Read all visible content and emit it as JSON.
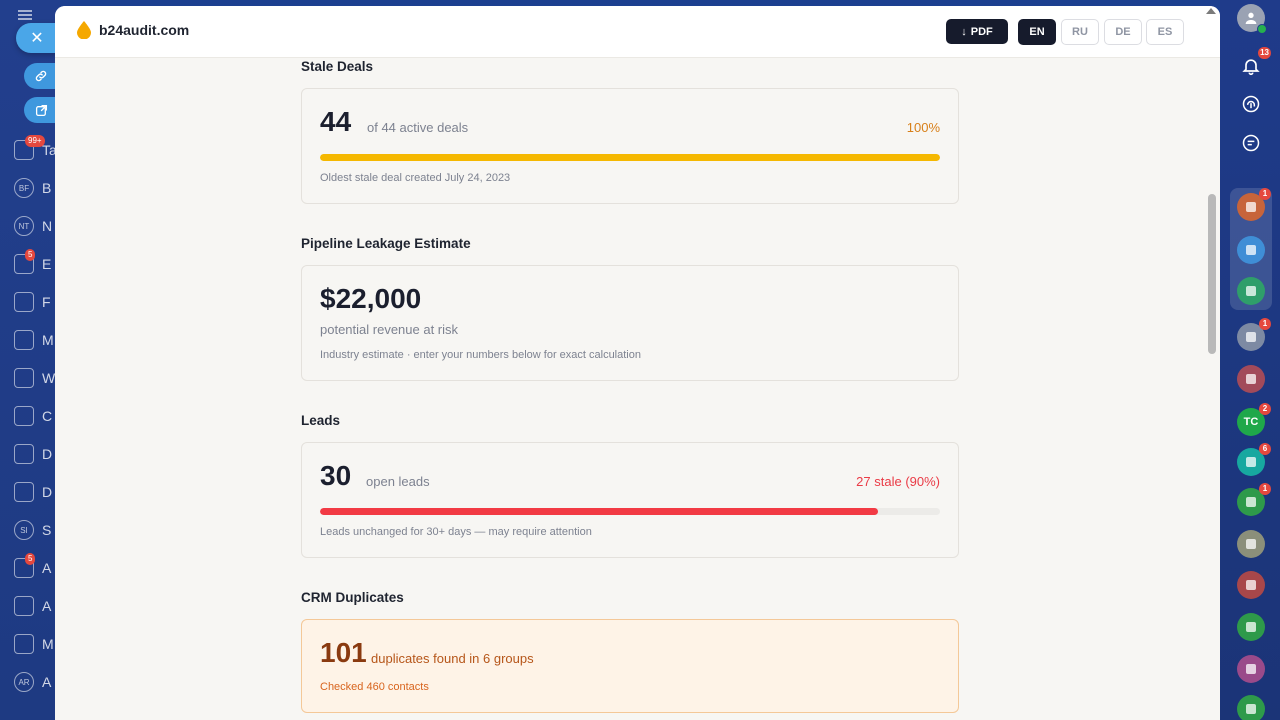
{
  "header": {
    "brand": "b24audit.com",
    "pdf_label": "PDF",
    "languages": [
      {
        "code": "EN",
        "active": true
      },
      {
        "code": "RU",
        "active": false
      },
      {
        "code": "DE",
        "active": false
      },
      {
        "code": "ES",
        "active": false
      }
    ]
  },
  "sections": {
    "stale_deals": {
      "title": "Stale Deals",
      "count": "44",
      "count_label": "of 44 active deals",
      "percent_label": "100%",
      "progress": 1.0,
      "bar_color": "#f5b800",
      "note": "Oldest stale deal created July 24, 2023"
    },
    "pipeline": {
      "title": "Pipeline Leakage Estimate",
      "amount": "$22,000",
      "amount_label": "potential revenue at risk",
      "note": "Industry estimate · enter your numbers below for exact calculation"
    },
    "leads": {
      "title": "Leads",
      "count": "30",
      "count_label": "open leads",
      "stale_label": "27 stale (90%)",
      "progress": 0.9,
      "bar_color": "#f23a44",
      "note": "Leads unchanged for 30+ days — may require attention"
    },
    "duplicates": {
      "title": "CRM Duplicates",
      "count": "101",
      "count_label": "duplicates found in 6 groups",
      "note": "Checked 460 contacts"
    }
  },
  "background_left": {
    "items": [
      {
        "abbr": "",
        "letter": "Ta",
        "badge": "99+"
      },
      {
        "abbr": "BF",
        "letter": "B",
        "badge": ""
      },
      {
        "abbr": "NT",
        "letter": "N",
        "badge": ""
      },
      {
        "abbr": "",
        "letter": "E",
        "badge": "5"
      },
      {
        "abbr": "",
        "letter": "F",
        "badge": ""
      },
      {
        "abbr": "",
        "letter": "M",
        "badge": ""
      },
      {
        "abbr": "",
        "letter": "W",
        "badge": ""
      },
      {
        "abbr": "",
        "letter": "C",
        "badge": ""
      },
      {
        "abbr": "",
        "letter": "D",
        "badge": ""
      },
      {
        "abbr": "",
        "letter": "D",
        "badge": ""
      },
      {
        "abbr": "SI",
        "letter": "S",
        "badge": ""
      },
      {
        "abbr": "",
        "letter": "A",
        "badge": "5"
      },
      {
        "abbr": "",
        "letter": "A",
        "badge": ""
      },
      {
        "abbr": "",
        "letter": "M",
        "badge": ""
      },
      {
        "abbr": "AR",
        "letter": "A",
        "badge": ""
      }
    ]
  },
  "background_right": {
    "notifications_badge": "13",
    "items": [
      {
        "name": "avatar-1",
        "badge": "1",
        "color": "#c7643a",
        "label": ""
      },
      {
        "name": "bookmark",
        "badge": "",
        "color": "#3f8ed6",
        "label": ""
      },
      {
        "name": "document",
        "badge": "",
        "color": "#2f9e6a",
        "label": ""
      },
      {
        "name": "avatar-2",
        "badge": "1",
        "color": "#7d8aa3",
        "label": ""
      },
      {
        "name": "contact-card",
        "badge": "",
        "color": "#a24a5a",
        "label": ""
      },
      {
        "name": "tc",
        "badge": "2",
        "color": "#1fa84a",
        "label": "TC"
      },
      {
        "name": "phone",
        "badge": "6",
        "color": "#17a8a0",
        "label": ""
      },
      {
        "name": "lock-1",
        "badge": "1",
        "color": "#2e9a4a",
        "label": ""
      },
      {
        "name": "avatar-3",
        "badge": "",
        "color": "#8b8f7a",
        "label": ""
      },
      {
        "name": "lock-2",
        "badge": "",
        "color": "#a8474a",
        "label": ""
      },
      {
        "name": "lock-3",
        "badge": "",
        "color": "#2e9a4a",
        "label": ""
      },
      {
        "name": "lock-4",
        "badge": "",
        "color": "#9a4a8a",
        "label": ""
      },
      {
        "name": "lock-5",
        "badge": "",
        "color": "#2e9a4a",
        "label": ""
      }
    ]
  }
}
